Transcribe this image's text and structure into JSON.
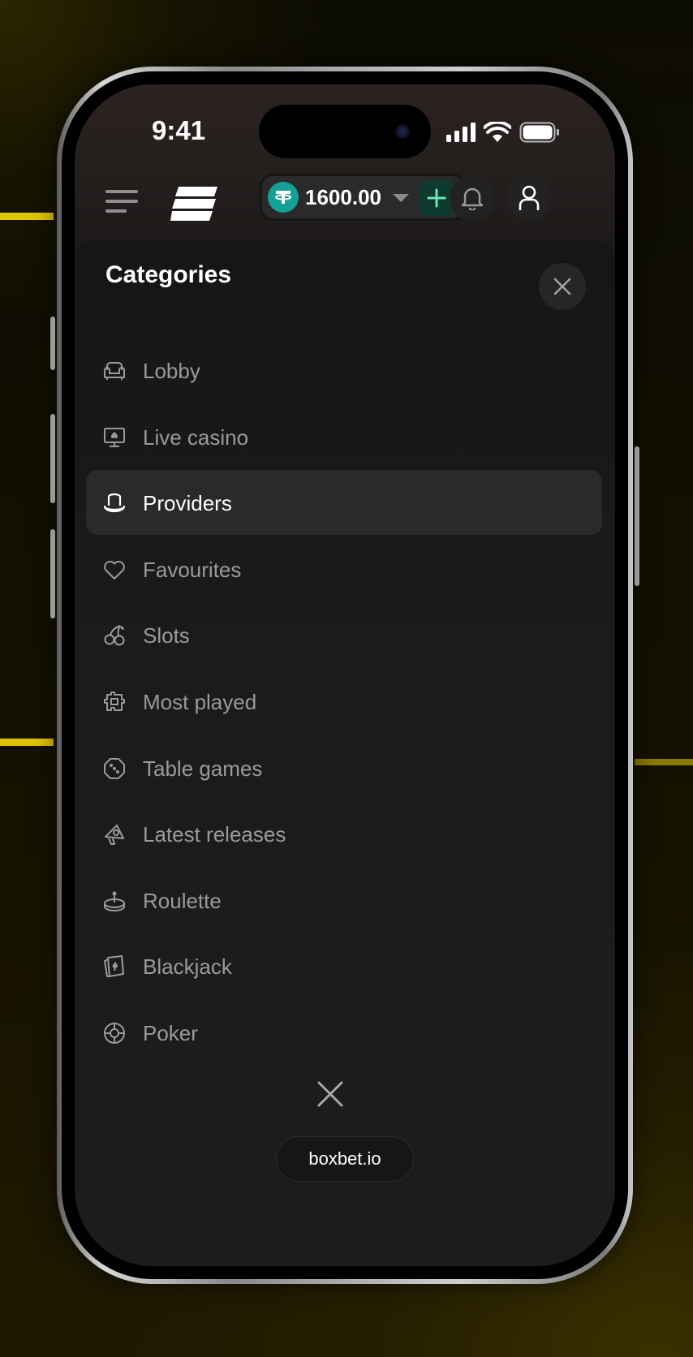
{
  "status_bar": {
    "time": "9:41"
  },
  "header": {
    "balance": "1600.00",
    "currency_icon": "tether-icon"
  },
  "sheet": {
    "title": "Categories",
    "items": [
      {
        "label": "Lobby",
        "icon": "armchair-icon",
        "active": false
      },
      {
        "label": "Live casino",
        "icon": "monitor-spade-icon",
        "active": false
      },
      {
        "label": "Providers",
        "icon": "top-hat-icon",
        "active": true
      },
      {
        "label": "Favourites",
        "icon": "heart-icon",
        "active": false
      },
      {
        "label": "Slots",
        "icon": "cherries-icon",
        "active": false
      },
      {
        "label": "Most played",
        "icon": "puzzle-icon",
        "active": false
      },
      {
        "label": "Table games",
        "icon": "dice-icon",
        "active": false
      },
      {
        "label": "Latest releases",
        "icon": "megaphone-icon",
        "active": false
      },
      {
        "label": "Roulette",
        "icon": "roulette-icon",
        "active": false
      },
      {
        "label": "Blackjack",
        "icon": "cards-icon",
        "active": false
      },
      {
        "label": "Poker",
        "icon": "poker-chip-icon",
        "active": false
      }
    ]
  },
  "browser": {
    "url": "boxbet.io"
  },
  "colors": {
    "accent_stripe": "#e1c400",
    "add_button": "#0f3a2f",
    "tether": "#14a195"
  }
}
